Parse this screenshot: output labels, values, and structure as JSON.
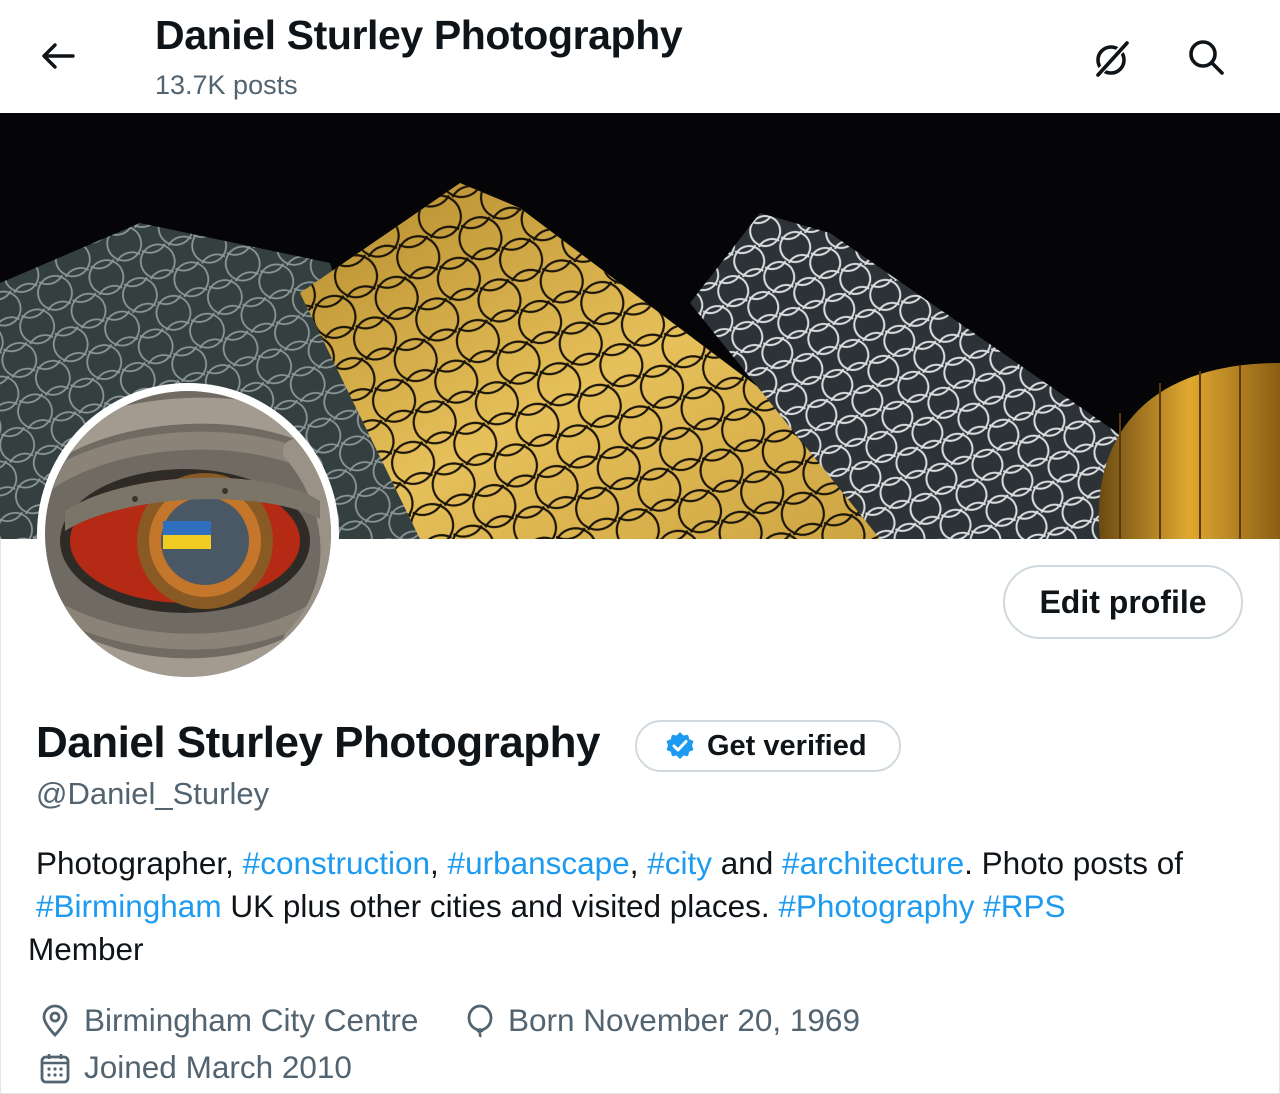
{
  "header": {
    "title": "Daniel Sturley Photography",
    "post_count": "13.7K posts",
    "back_icon": "arrow-left-icon",
    "grok_icon": "grok-icon",
    "search_icon": "search-icon"
  },
  "banner": {
    "description_icon": "library-facade-banner-image"
  },
  "profile": {
    "name": "Daniel Sturley Photography",
    "handle": "@Daniel_Sturley",
    "edit_label": "Edit profile",
    "verify_label": "Get verified",
    "verify_icon": "verified-badge-icon"
  },
  "bio": {
    "t1": "Photographer, ",
    "h1": "#construction",
    "t2": ", ",
    "h2": "#urbanscape",
    "t3": ", ",
    "h3": "#city",
    "t4": " and ",
    "h4": "#architecture",
    "t5": ". Photo posts of ",
    "h5": "#Birmingham",
    "t6": " UK plus other cities and visited places. ",
    "h6": "#Photography",
    "t7": " ",
    "h7": "#RPS",
    "t8": " Member"
  },
  "meta": {
    "location": "Birmingham City Centre",
    "birth": "Born November 20, 1969",
    "joined": "Joined March 2010"
  },
  "colors": {
    "link": "#1d9bf0",
    "secondary_text": "#536471",
    "primary_text": "#0f1419",
    "border": "#cfd9de"
  }
}
